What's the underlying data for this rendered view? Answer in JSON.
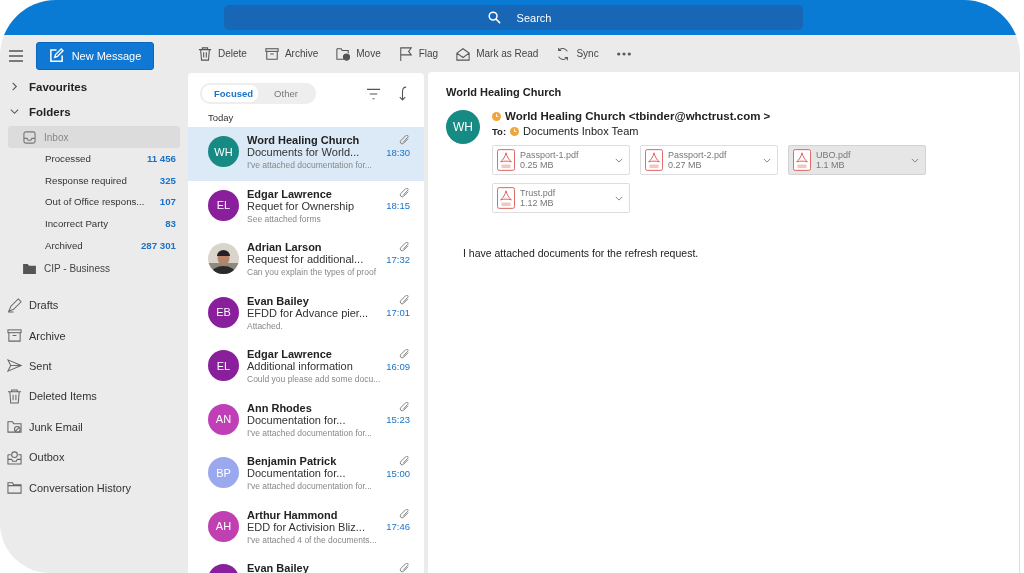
{
  "search": {
    "placeholder": "Search"
  },
  "new_message": {
    "label": "New Message"
  },
  "toolbar": [
    {
      "kind": "delete",
      "label": "Delete"
    },
    {
      "kind": "archive",
      "label": "Archive"
    },
    {
      "kind": "move",
      "label": "Move"
    },
    {
      "kind": "flag",
      "label": "Flag"
    },
    {
      "kind": "read",
      "label": "Mark as Read"
    },
    {
      "kind": "sync",
      "label": "Sync"
    },
    {
      "kind": "more"
    }
  ],
  "sidebar": {
    "sections": [
      {
        "label": "Favourites",
        "expanded": false
      },
      {
        "label": "Folders",
        "expanded": true
      }
    ],
    "folders": [
      {
        "kind": "inbox",
        "label": "Inbox",
        "selected": true,
        "children": [
          {
            "label": "Processed",
            "count": "11 456"
          },
          {
            "label": "Response required",
            "count": "325"
          },
          {
            "label": "Out of Office respons...",
            "count": "107"
          },
          {
            "label": "Incorrect Party",
            "count": "83"
          },
          {
            "label": "Archived",
            "count": "287 301"
          }
        ]
      },
      {
        "kind": "folder-filled",
        "label": "CIP - Business",
        "selected": false
      }
    ],
    "mail_folders": [
      {
        "kind": "drafts",
        "label": "Drafts"
      },
      {
        "kind": "archive",
        "label": "Archive"
      },
      {
        "kind": "sent",
        "label": "Sent"
      },
      {
        "kind": "deleted",
        "label": "Deleted Items"
      },
      {
        "kind": "junk",
        "label": "Junk Email"
      },
      {
        "kind": "outbox",
        "label": "Outbox"
      },
      {
        "kind": "folder",
        "label": "Conversation History"
      }
    ]
  },
  "message_list": {
    "tabs": [
      {
        "label": "Focused",
        "selected": true
      },
      {
        "label": "Other",
        "selected": false
      }
    ],
    "group": "Today",
    "messages": [
      {
        "avatar": {
          "kind": "initials",
          "initials": "WH",
          "color": "#178a83"
        },
        "sender": "Word Healing Church",
        "subject": "Documents for World...",
        "time": "18:30",
        "preview": "I've attached documentation for...",
        "selected": true,
        "attachment": true
      },
      {
        "avatar": {
          "kind": "initials",
          "initials": "EL",
          "color": "#8a1f9c"
        },
        "sender": "Edgar Lawrence",
        "subject": "Requet for Ownership",
        "time": "18:15",
        "preview": "See attached forms",
        "selected": false,
        "attachment": true
      },
      {
        "sender": "Adrian Larson",
        "subject": "Request for additional...",
        "time": "17:32",
        "preview": "Can you explain the types of proof",
        "selected": false,
        "attachment": true
      },
      {
        "avatar": {
          "kind": "initials",
          "initials": "EB",
          "color": "#8a1f9c"
        },
        "sender": "Evan Bailey",
        "subject": "EFDD for Advance pier...",
        "time": "17:01",
        "preview": "Attached.",
        "selected": false,
        "attachment": true
      },
      {
        "avatar": {
          "kind": "initials",
          "initials": "EL",
          "color": "#8a1f9c"
        },
        "sender": "Edgar Lawrence",
        "subject": "Additional information",
        "time": "16:09",
        "preview": "Could you please add some docu...",
        "selected": false,
        "attachment": true
      },
      {
        "avatar": {
          "kind": "initials",
          "initials": "AN",
          "color": "#c13fb6"
        },
        "sender": "Ann Rhodes",
        "subject": "Documentation for...",
        "time": "15:23",
        "preview": "I've attached documentation for...",
        "selected": false,
        "attachment": true
      },
      {
        "avatar": {
          "kind": "initials",
          "initials": "BP",
          "color": "#9aa9ee"
        },
        "sender": "Benjamin Patrick",
        "subject": "Documentation for...",
        "time": "15:00",
        "preview": "I've attached documentation for...",
        "selected": false,
        "attachment": true
      },
      {
        "avatar": {
          "kind": "initials",
          "initials": "AH",
          "color": "#c040b2"
        },
        "sender": "Arthur Hammond",
        "subject": "EDD for Activision Bliz...",
        "time": "17:46",
        "preview": "I've attached 4 of the documents...",
        "selected": false,
        "attachment": true
      },
      {
        "avatar": {
          "kind": "initials",
          "color": "#8a1f9c"
        },
        "sender": "Evan Bailey",
        "attachment": true,
        "selected": false
      }
    ]
  },
  "reading_pane": {
    "title": "World Healing Church",
    "avatar": {
      "initials": "WH",
      "color": "#178a83"
    },
    "from": "World Healing Church <tbinder@whctrust.com >",
    "to_label": "To:",
    "to": "Documents Inbox Team",
    "attachments": [
      {
        "name": "Passport-1.pdf",
        "size": "0.25 MB",
        "selected": false
      },
      {
        "name": "Passport-2.pdf",
        "size": "0.27 MB",
        "selected": false
      },
      {
        "name": "UBO.pdf",
        "size": "1.1 MB",
        "selected": true
      },
      {
        "name": "Trust.pdf",
        "size": "1.12 MB",
        "selected": false
      }
    ],
    "body": "I have attached documents for the refresh request."
  }
}
